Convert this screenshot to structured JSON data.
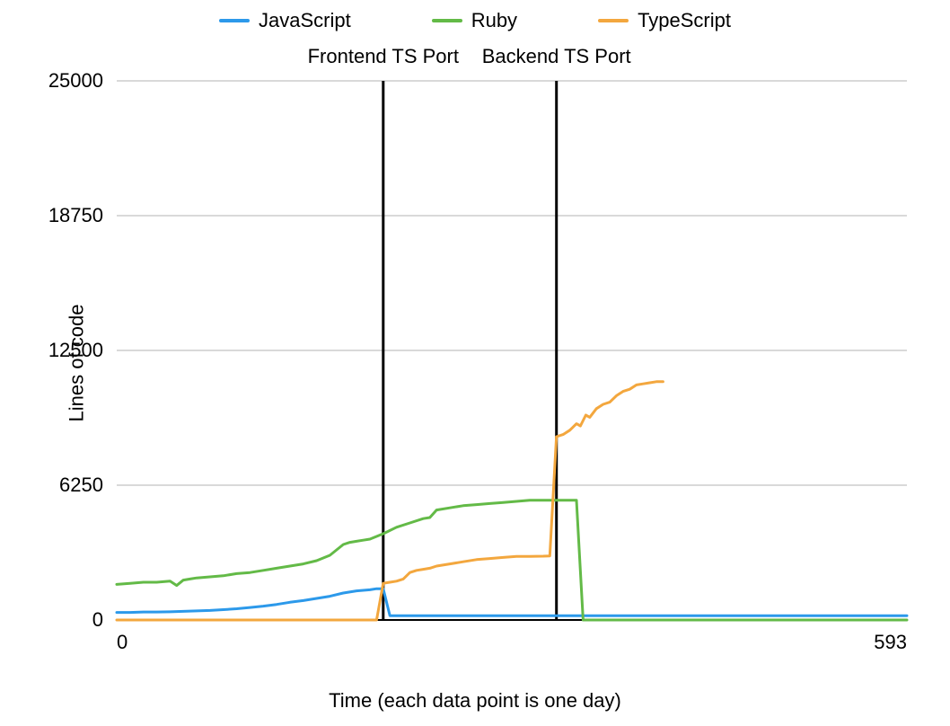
{
  "chart_data": {
    "type": "line",
    "title": "",
    "xlabel": "Time (each data point is one day)",
    "ylabel": "Lines of code",
    "xlim": [
      0,
      593
    ],
    "ylim": [
      0,
      25000
    ],
    "xticks": [
      0,
      593
    ],
    "yticks": [
      0,
      6250,
      12500,
      18750,
      25000
    ],
    "grid_y": true,
    "grid_x": false,
    "legend_position": "top",
    "annotations": [
      {
        "label": "Frontend TS Port",
        "x": 200,
        "type": "vline"
      },
      {
        "label": "Backend TS Port",
        "x": 330,
        "type": "vline"
      }
    ],
    "colors": {
      "JavaScript": "#2c99ea",
      "Ruby": "#63ba47",
      "TypeScript": "#f3a73e",
      "grid": "#d9d9d9",
      "axis": "#000000",
      "annotation_line": "#000000"
    },
    "series": [
      {
        "name": "JavaScript",
        "data": [
          {
            "x": 0,
            "y": 350
          },
          {
            "x": 10,
            "y": 350
          },
          {
            "x": 20,
            "y": 370
          },
          {
            "x": 30,
            "y": 370
          },
          {
            "x": 40,
            "y": 380
          },
          {
            "x": 50,
            "y": 400
          },
          {
            "x": 60,
            "y": 420
          },
          {
            "x": 70,
            "y": 440
          },
          {
            "x": 80,
            "y": 480
          },
          {
            "x": 90,
            "y": 520
          },
          {
            "x": 100,
            "y": 580
          },
          {
            "x": 110,
            "y": 640
          },
          {
            "x": 120,
            "y": 720
          },
          {
            "x": 130,
            "y": 820
          },
          {
            "x": 140,
            "y": 900
          },
          {
            "x": 150,
            "y": 1000
          },
          {
            "x": 160,
            "y": 1100
          },
          {
            "x": 170,
            "y": 1250
          },
          {
            "x": 180,
            "y": 1350
          },
          {
            "x": 190,
            "y": 1400
          },
          {
            "x": 195,
            "y": 1450
          },
          {
            "x": 200,
            "y": 1450
          },
          {
            "x": 205,
            "y": 200
          },
          {
            "x": 210,
            "y": 200
          },
          {
            "x": 230,
            "y": 200
          },
          {
            "x": 260,
            "y": 200
          },
          {
            "x": 300,
            "y": 200
          },
          {
            "x": 340,
            "y": 200
          },
          {
            "x": 380,
            "y": 200
          },
          {
            "x": 420,
            "y": 200
          },
          {
            "x": 500,
            "y": 200
          },
          {
            "x": 593,
            "y": 200
          }
        ]
      },
      {
        "name": "Ruby",
        "data": [
          {
            "x": 0,
            "y": 1650
          },
          {
            "x": 10,
            "y": 1700
          },
          {
            "x": 20,
            "y": 1750
          },
          {
            "x": 30,
            "y": 1750
          },
          {
            "x": 40,
            "y": 1800
          },
          {
            "x": 45,
            "y": 1600
          },
          {
            "x": 50,
            "y": 1850
          },
          {
            "x": 55,
            "y": 1900
          },
          {
            "x": 60,
            "y": 1950
          },
          {
            "x": 70,
            "y": 2000
          },
          {
            "x": 80,
            "y": 2050
          },
          {
            "x": 90,
            "y": 2150
          },
          {
            "x": 100,
            "y": 2200
          },
          {
            "x": 110,
            "y": 2300
          },
          {
            "x": 120,
            "y": 2400
          },
          {
            "x": 130,
            "y": 2500
          },
          {
            "x": 140,
            "y": 2600
          },
          {
            "x": 150,
            "y": 2750
          },
          {
            "x": 160,
            "y": 3000
          },
          {
            "x": 170,
            "y": 3500
          },
          {
            "x": 175,
            "y": 3600
          },
          {
            "x": 180,
            "y": 3650
          },
          {
            "x": 185,
            "y": 3700
          },
          {
            "x": 190,
            "y": 3750
          },
          {
            "x": 200,
            "y": 4000
          },
          {
            "x": 210,
            "y": 4300
          },
          {
            "x": 220,
            "y": 4500
          },
          {
            "x": 230,
            "y": 4700
          },
          {
            "x": 235,
            "y": 4750
          },
          {
            "x": 240,
            "y": 5100
          },
          {
            "x": 250,
            "y": 5200
          },
          {
            "x": 260,
            "y": 5300
          },
          {
            "x": 270,
            "y": 5350
          },
          {
            "x": 280,
            "y": 5400
          },
          {
            "x": 290,
            "y": 5450
          },
          {
            "x": 300,
            "y": 5500
          },
          {
            "x": 310,
            "y": 5550
          },
          {
            "x": 320,
            "y": 5550
          },
          {
            "x": 330,
            "y": 5550
          },
          {
            "x": 340,
            "y": 5550
          },
          {
            "x": 345,
            "y": 5550
          },
          {
            "x": 350,
            "y": 0
          },
          {
            "x": 360,
            "y": 0
          },
          {
            "x": 400,
            "y": 0
          },
          {
            "x": 500,
            "y": 0
          },
          {
            "x": 593,
            "y": 0
          }
        ]
      },
      {
        "name": "TypeScript",
        "data": [
          {
            "x": 0,
            "y": 0
          },
          {
            "x": 50,
            "y": 0
          },
          {
            "x": 100,
            "y": 0
          },
          {
            "x": 150,
            "y": 0
          },
          {
            "x": 190,
            "y": 0
          },
          {
            "x": 195,
            "y": 0
          },
          {
            "x": 200,
            "y": 1700
          },
          {
            "x": 205,
            "y": 1750
          },
          {
            "x": 210,
            "y": 1800
          },
          {
            "x": 215,
            "y": 1900
          },
          {
            "x": 220,
            "y": 2200
          },
          {
            "x": 225,
            "y": 2300
          },
          {
            "x": 230,
            "y": 2350
          },
          {
            "x": 235,
            "y": 2400
          },
          {
            "x": 240,
            "y": 2500
          },
          {
            "x": 250,
            "y": 2600
          },
          {
            "x": 260,
            "y": 2700
          },
          {
            "x": 270,
            "y": 2800
          },
          {
            "x": 280,
            "y": 2850
          },
          {
            "x": 290,
            "y": 2900
          },
          {
            "x": 300,
            "y": 2950
          },
          {
            "x": 310,
            "y": 2950
          },
          {
            "x": 320,
            "y": 2960
          },
          {
            "x": 325,
            "y": 2970
          },
          {
            "x": 330,
            "y": 8500
          },
          {
            "x": 335,
            "y": 8600
          },
          {
            "x": 340,
            "y": 8800
          },
          {
            "x": 345,
            "y": 9100
          },
          {
            "x": 348,
            "y": 9000
          },
          {
            "x": 352,
            "y": 9500
          },
          {
            "x": 355,
            "y": 9400
          },
          {
            "x": 360,
            "y": 9800
          },
          {
            "x": 365,
            "y": 10000
          },
          {
            "x": 370,
            "y": 10100
          },
          {
            "x": 375,
            "y": 10400
          },
          {
            "x": 380,
            "y": 10600
          },
          {
            "x": 385,
            "y": 10700
          },
          {
            "x": 390,
            "y": 10900
          },
          {
            "x": 395,
            "y": 10950
          },
          {
            "x": 400,
            "y": 11000
          },
          {
            "x": 405,
            "y": 11050
          },
          {
            "x": 410,
            "y": 11050
          }
        ]
      }
    ]
  },
  "legend": {
    "items": [
      {
        "label": "JavaScript",
        "series_key": "JavaScript"
      },
      {
        "label": "Ruby",
        "series_key": "Ruby"
      },
      {
        "label": "TypeScript",
        "series_key": "TypeScript"
      }
    ]
  }
}
